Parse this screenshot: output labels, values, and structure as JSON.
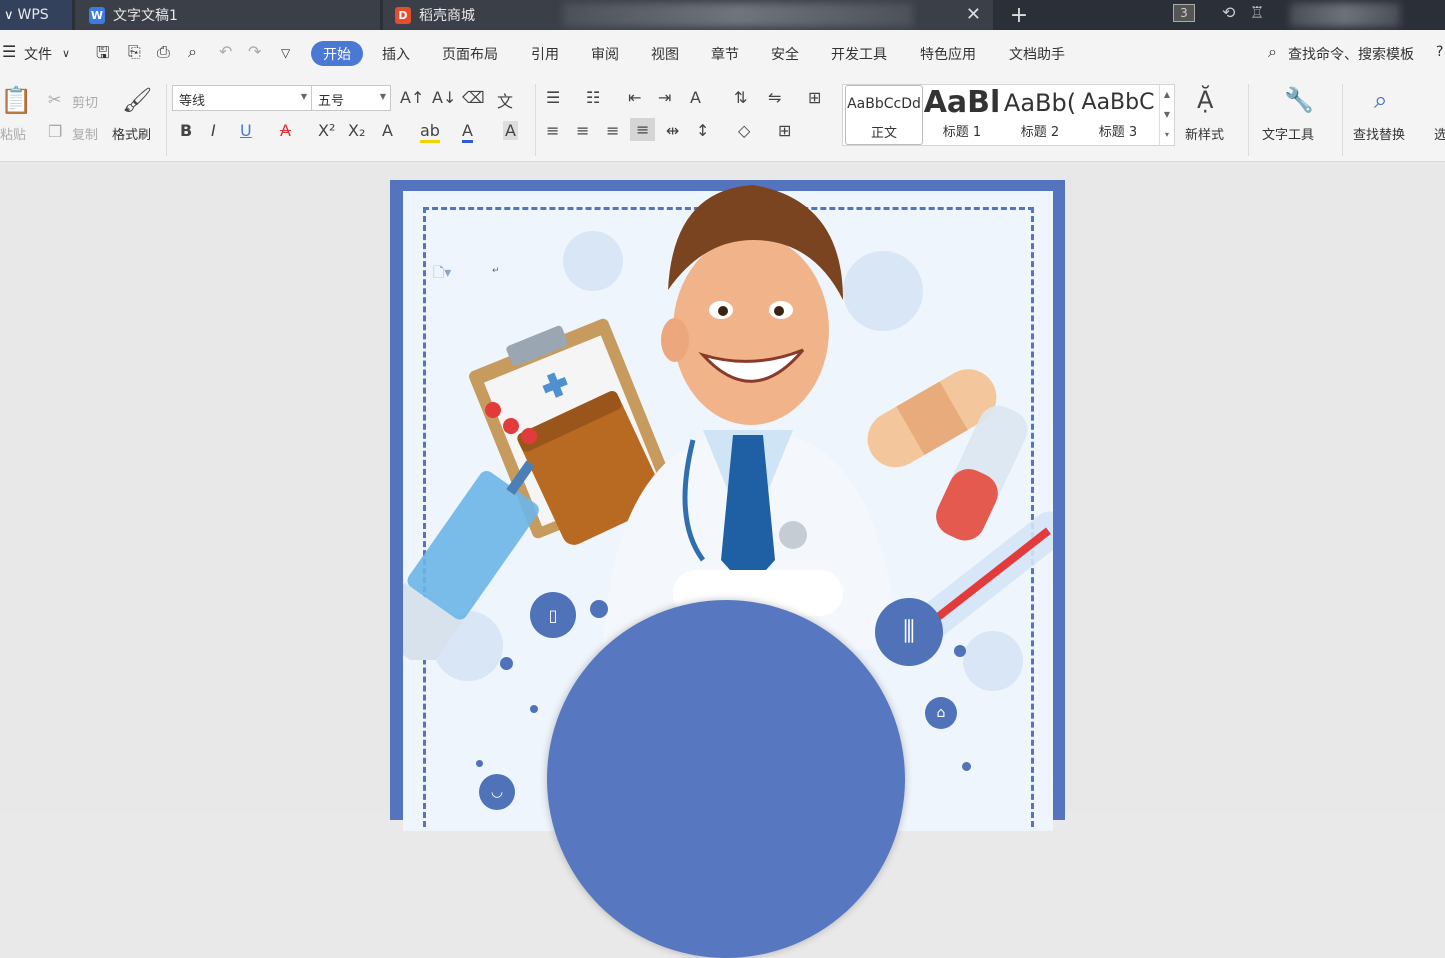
{
  "titlebar": {
    "app_tab": "WPS",
    "doc_tab": "文字文稿1",
    "store_tab": "稻壳商城",
    "new_tab": "+",
    "close": "✕",
    "badge": "3"
  },
  "menu": {
    "file": "文件",
    "items": [
      "开始",
      "插入",
      "页面布局",
      "引用",
      "审阅",
      "视图",
      "章节",
      "安全",
      "开发工具",
      "特色应用",
      "文档助手"
    ],
    "search": "查找命令、搜索模板"
  },
  "ribbon": {
    "clipboard": {
      "cut": "剪切",
      "copy": "复制",
      "paste": "粘贴",
      "format_painter": "格式刷"
    },
    "font": {
      "name": "等线",
      "size": "五号"
    },
    "format_buttons": {
      "bold": "B",
      "italic": "I",
      "underline": "U"
    },
    "styles": [
      {
        "preview": "AaBbCcDd",
        "label": "正文"
      },
      {
        "preview": "AaBl",
        "label": "标题 1"
      },
      {
        "preview": "AaBb(",
        "label": "标题 2"
      },
      {
        "preview": "AaBbC",
        "label": "标题 3"
      }
    ],
    "new_style": "新样式",
    "text_tools": "文字工具",
    "find_replace": "查找替换",
    "select": "选"
  },
  "doc_marker": "↵",
  "colors": {
    "accent": "#4a78d4",
    "page_frame": "#5474bd",
    "titlebar": "#2b2f38"
  }
}
